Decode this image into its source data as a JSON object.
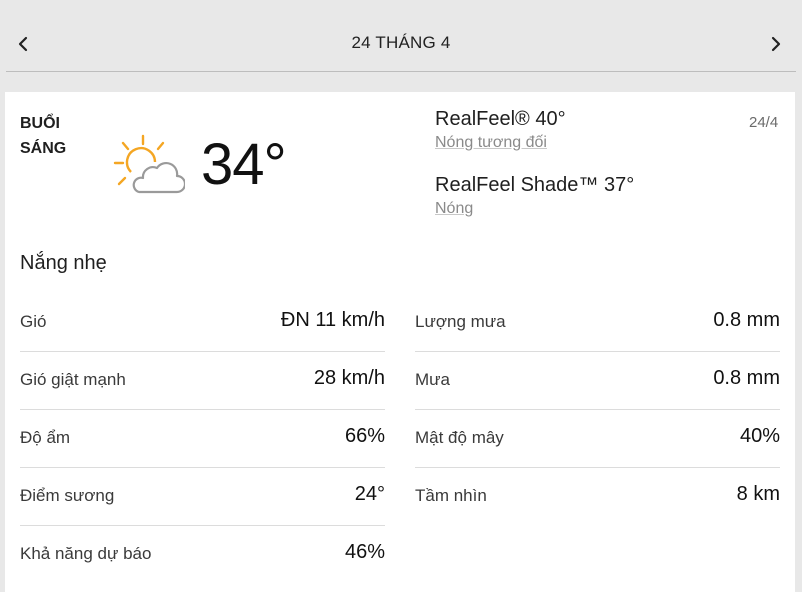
{
  "nav": {
    "date_label": "24 THÁNG 4",
    "prev_icon": "chevron-left-icon",
    "next_icon": "chevron-right-icon"
  },
  "card": {
    "period_line1": "BUỔI",
    "period_line2": "SÁNG",
    "icon": "partly-sunny-icon",
    "temperature": "34°",
    "realfeel": "RealFeel® 40°",
    "realfeel_desc": "Nóng tương đối",
    "realfeel_shade": "RealFeel Shade™ 37°",
    "realfeel_shade_desc": "Nóng",
    "short_date": "24/4",
    "phrase": "Nắng nhẹ",
    "colors": {
      "sun": "#f4a623",
      "cloud_stroke": "#9a9a9a"
    }
  },
  "details": {
    "left": [
      {
        "label": "Gió",
        "value": "ĐN 11 km/h"
      },
      {
        "label": "Gió giật mạnh",
        "value": "28 km/h"
      },
      {
        "label": "Độ ẩm",
        "value": "66%"
      },
      {
        "label": "Điểm sương",
        "value": "24°"
      },
      {
        "label": "Khả năng dự báo",
        "value": "46%"
      }
    ],
    "right": [
      {
        "label": "Lượng mưa",
        "value": "0.8 mm"
      },
      {
        "label": "Mưa",
        "value": "0.8 mm"
      },
      {
        "label": "Mật độ mây",
        "value": "40%"
      },
      {
        "label": "Tầm nhìn",
        "value": "8 km"
      }
    ]
  }
}
